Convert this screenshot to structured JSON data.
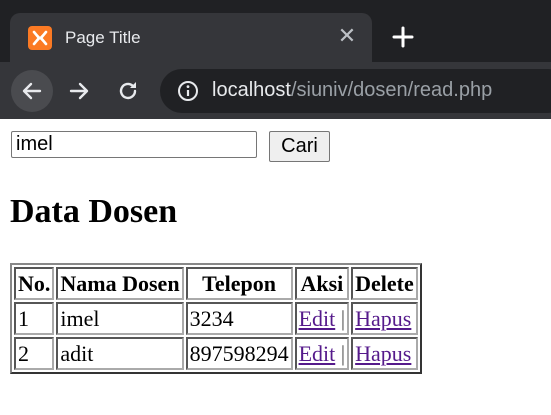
{
  "browser": {
    "tab_title": "Page Title",
    "tab_close_icon": "close-icon",
    "new_tab_icon": "plus-icon",
    "url_host": "localhost",
    "url_path": "/siuniv/dosen/read.php"
  },
  "search": {
    "value": "imel",
    "button_label": "Cari"
  },
  "page_title": "Data Dosen",
  "table": {
    "headers": [
      "No.",
      "Nama Dosen",
      "Telepon",
      "Aksi",
      "Delete"
    ],
    "rows": [
      {
        "no": "1",
        "nama": "imel",
        "telepon": "3234",
        "edit": "Edit",
        "sep": "|",
        "hapus": "Hapus"
      },
      {
        "no": "2",
        "nama": "adit",
        "telepon": "897598294",
        "edit": "Edit",
        "sep": "|",
        "hapus": "Hapus"
      }
    ]
  },
  "colors": {
    "favicon": "#fb7a24",
    "visited_link": "#551a8b",
    "chrome_dark": "#202124",
    "chrome_mid": "#35363a"
  }
}
